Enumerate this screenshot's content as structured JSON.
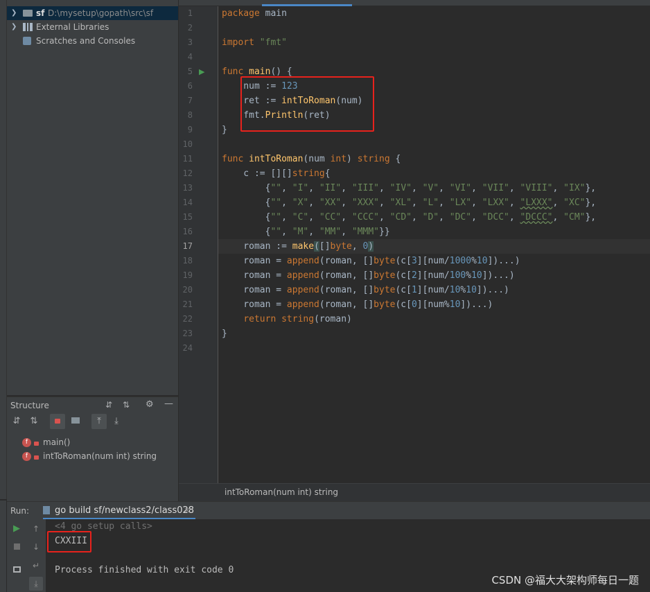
{
  "project": {
    "root_name": "sf",
    "root_path": "D:\\mysetup\\gopath\\src\\sf",
    "external_libraries": "External Libraries",
    "scratches": "Scratches and Consoles"
  },
  "structure": {
    "title": "Structure",
    "items": [
      {
        "badge": "f",
        "label": "main()"
      },
      {
        "badge": "f",
        "label": "intToRoman(num int) string"
      }
    ]
  },
  "editor": {
    "line_numbers": [
      "1",
      "2",
      "3",
      "4",
      "5",
      "6",
      "7",
      "8",
      "9",
      "10",
      "11",
      "12",
      "13",
      "14",
      "15",
      "16",
      "17",
      "18",
      "19",
      "20",
      "21",
      "22",
      "23",
      "24"
    ],
    "current_line": "17",
    "breadcrumb": "intToRoman(num int) string"
  },
  "run": {
    "label": "Run:",
    "tab_label": "go build sf/newclass2/class028",
    "output": {
      "setup_calls": "<4 go setup calls>",
      "result": "CXXIII",
      "exit": "Process finished with exit code 0"
    }
  },
  "watermark": "CSDN @福大大架构师每日一题",
  "colors": {
    "highlight_box": "#e8221c",
    "keyword": "#cc7832",
    "function": "#ffc66d",
    "string": "#6a8759",
    "number": "#6897bb"
  }
}
